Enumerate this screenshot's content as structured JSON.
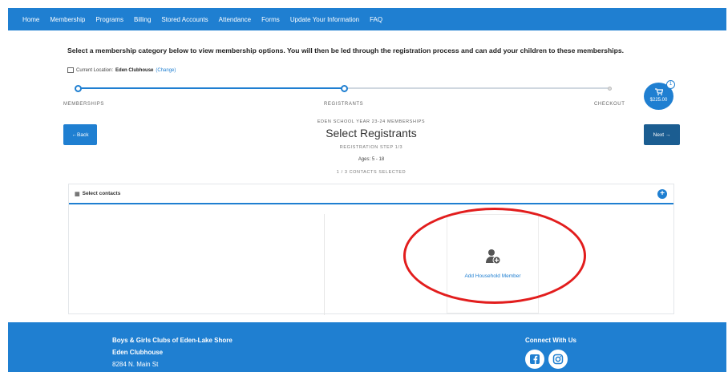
{
  "nav": {
    "items": [
      "Home",
      "Membership",
      "Programs",
      "Billing",
      "Stored Accounts",
      "Attendance",
      "Forms",
      "Update Your Information",
      "FAQ"
    ]
  },
  "instructions": "Select a membership category below to view membership options. You will then be led through the registration process and can add your children to these memberships.",
  "location": {
    "label": "Current Location:",
    "name": "Eden Clubhouse",
    "change": "(Change)"
  },
  "progress": {
    "steps": [
      "MEMBERSHIPS",
      "REGISTRANTS",
      "CHECKOUT"
    ],
    "current_step": 2
  },
  "cart": {
    "count": "1",
    "total": "$225.00",
    "icon": "cart-icon"
  },
  "buttons": {
    "back": "←Back",
    "next": "Next →"
  },
  "header": {
    "eyebrow": "EDEN SCHOOL YEAR 23-24 MEMBERSHIPS",
    "title": "Select Registrants",
    "step": "REGISTRATION STEP 1/3",
    "ages": "Ages: 5 - 18",
    "selected": "1 / 3 CONTACTS SELECTED"
  },
  "panel": {
    "title": "Select contacts",
    "add_member": "Add Household Member"
  },
  "footer": {
    "org": "Boys & Girls Clubs of Eden-Lake Shore",
    "club": "Eden Clubhouse",
    "address": "8284 N. Main St",
    "connect": "Connect With Us"
  },
  "colors": {
    "primary": "#1f7fd1",
    "next_button": "#1b5d91",
    "highlight": "#e21d1d"
  }
}
